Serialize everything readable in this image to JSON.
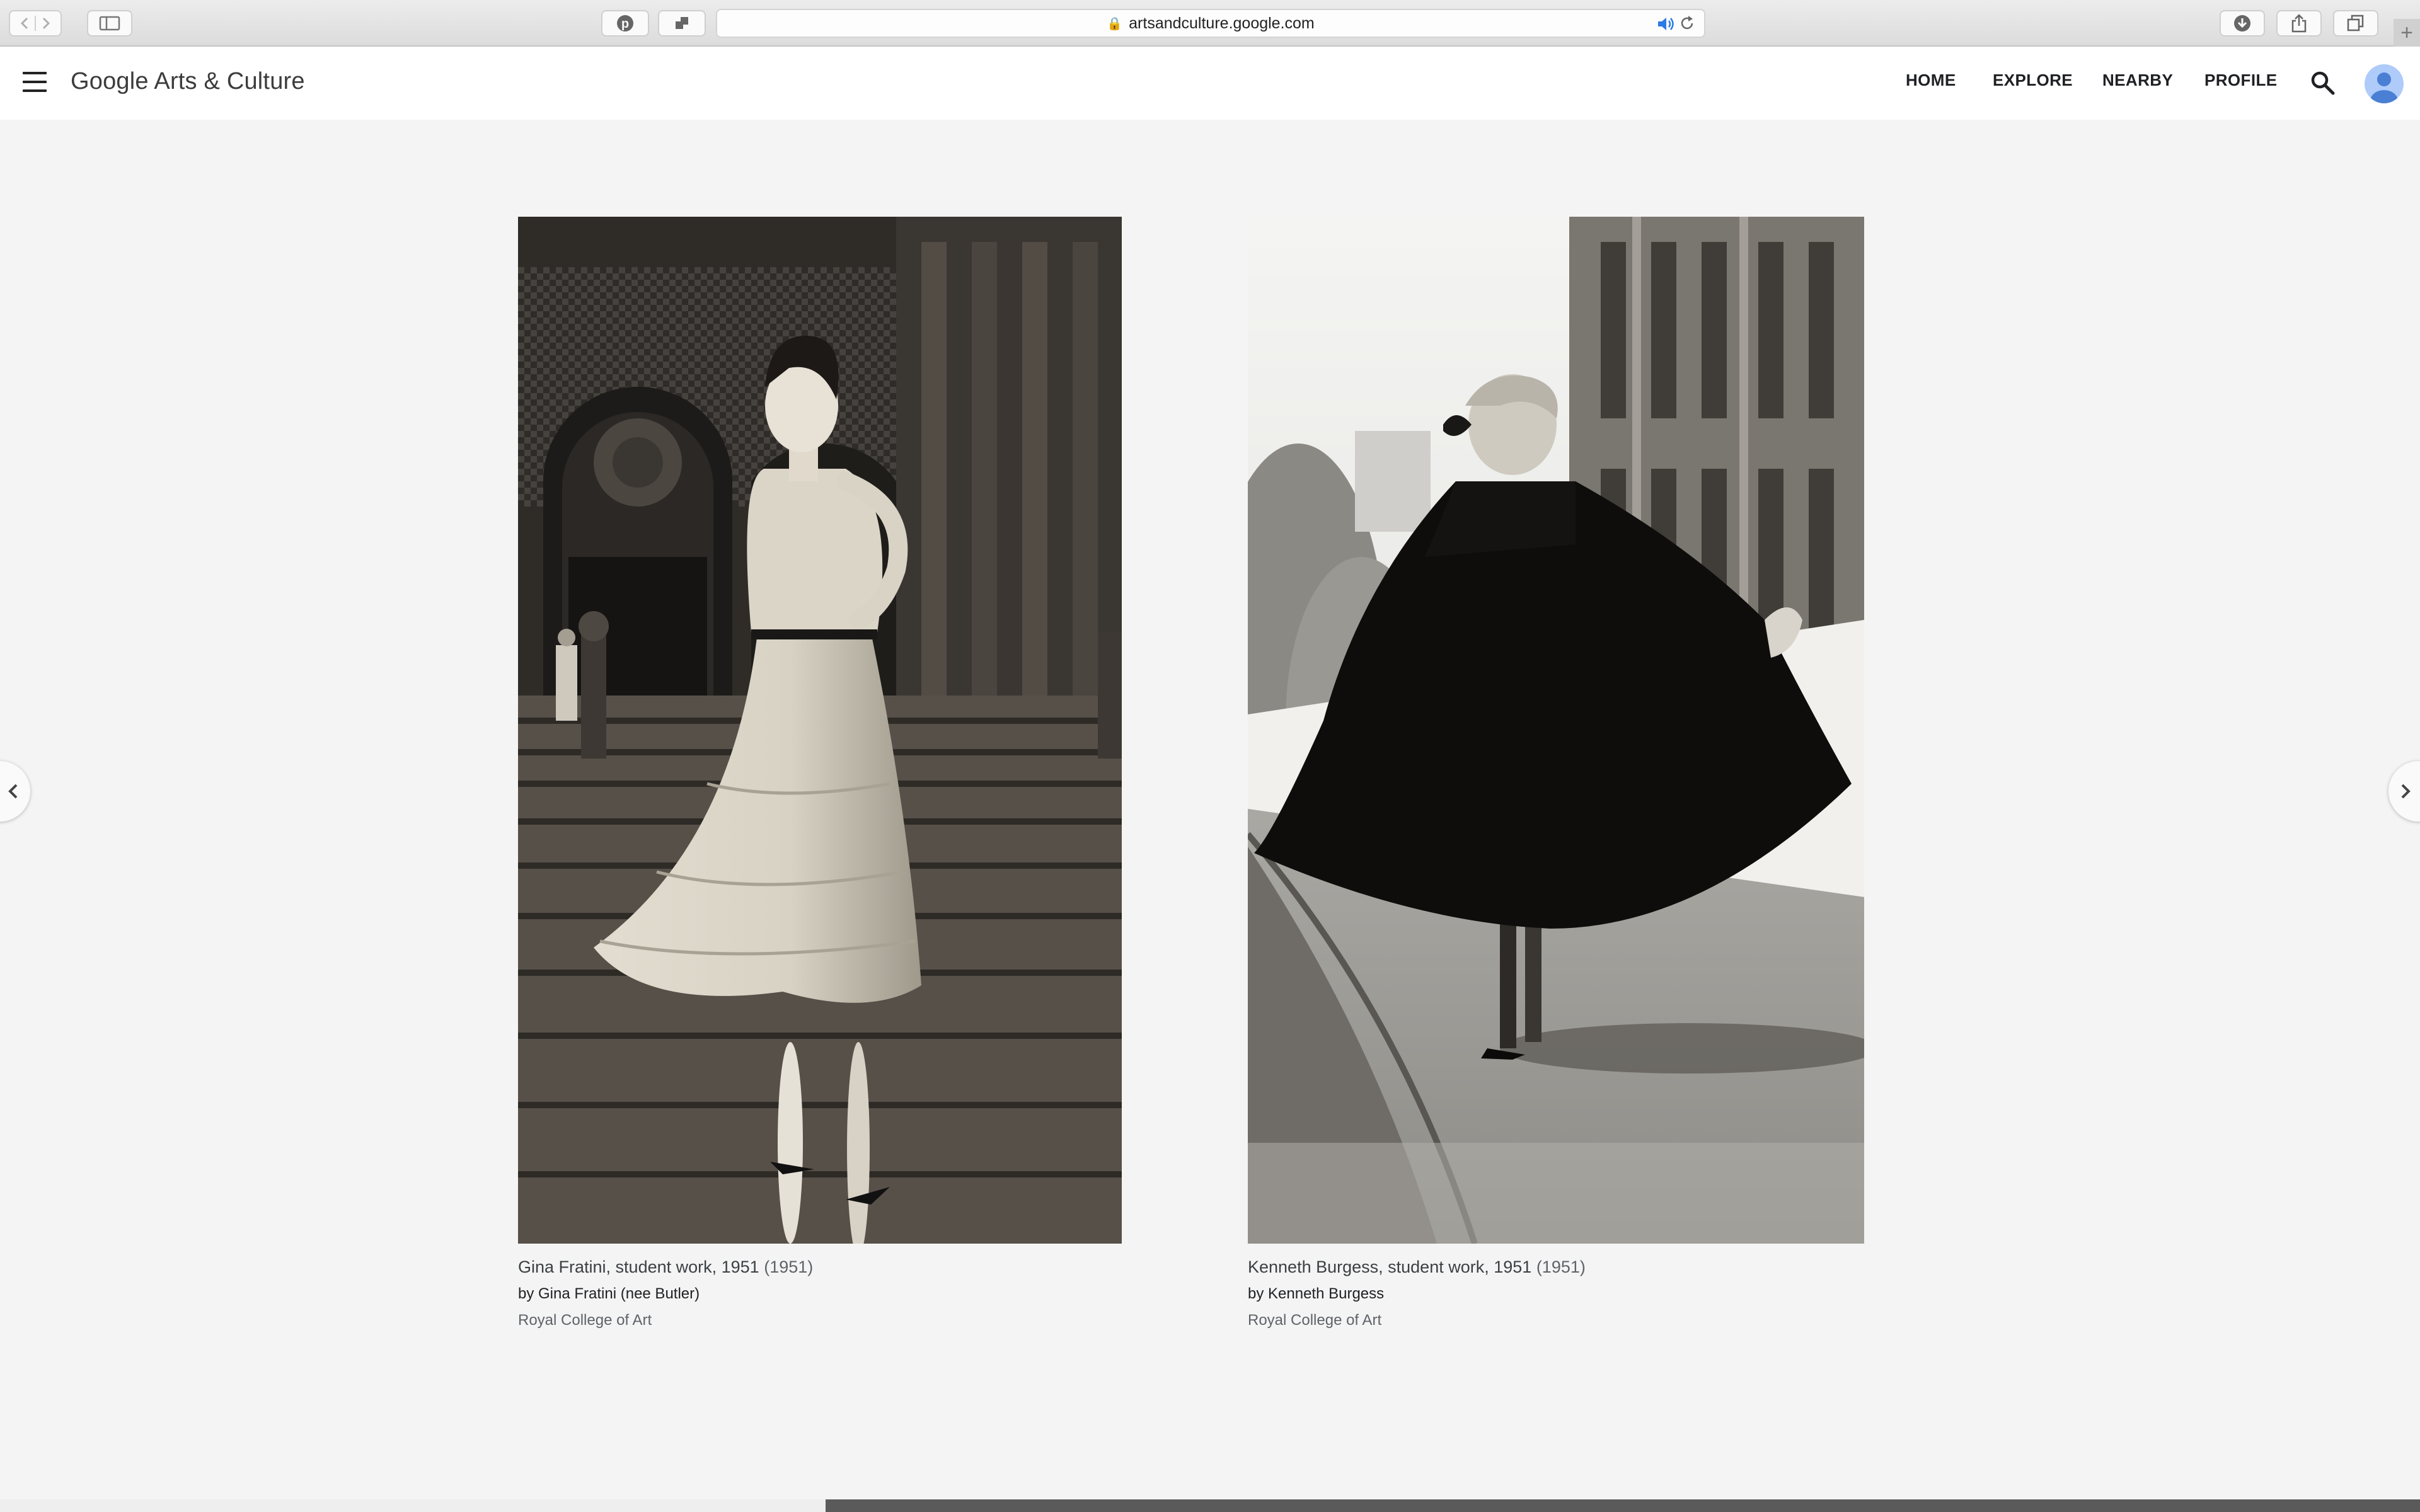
{
  "browser": {
    "url": "artsandculture.google.com"
  },
  "header": {
    "brand": "Google Arts & Culture",
    "nav": [
      "HOME",
      "EXPLORE",
      "NEARBY",
      "PROFILE"
    ]
  },
  "artworks": [
    {
      "title": "Gina Fratini, student work, 1951",
      "year": "(1951)",
      "creator": "by Gina Fratini (nee Butler)",
      "institution": "Royal College of Art"
    },
    {
      "title": "Kenneth Burgess, student work, 1951",
      "year": "(1951)",
      "creator": "by Kenneth Burgess",
      "institution": "Royal College of Art"
    }
  ],
  "icons": {
    "menu": "hamburger-menu-icon",
    "search": "search-icon",
    "avatar": "account-avatar-icon",
    "prev": "chevron-left-icon",
    "next": "chevron-right-icon"
  },
  "colors": {
    "page_background": "#f4f4f4",
    "header_background": "#ffffff",
    "avatar": "#aecbfa"
  }
}
